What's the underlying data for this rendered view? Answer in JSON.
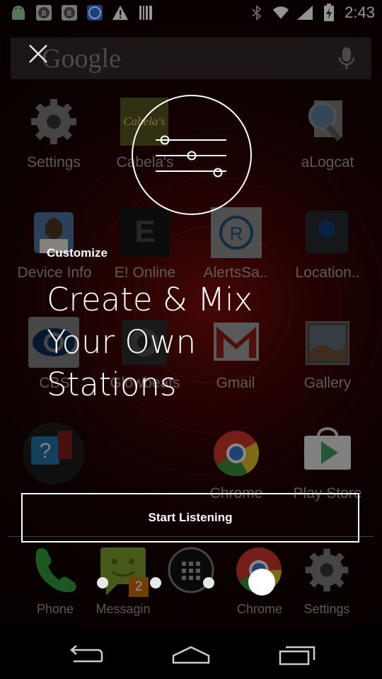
{
  "status_bar": {
    "time": "2:43",
    "left_icons": [
      "android-icon",
      "badge-b-icon",
      "badge-b-icon",
      "circle-app-icon",
      "warning-icon",
      "barcode-icon"
    ],
    "right_icons": [
      "bluetooth-icon",
      "wifi-icon",
      "signal-icon",
      "battery-charging-icon"
    ]
  },
  "search": {
    "placeholder": "Google"
  },
  "apps": [
    {
      "label": "Settings",
      "icon": "gear-icon"
    },
    {
      "label": "Cabela's",
      "icon": "cabelas-icon"
    },
    {
      "label": "aLogcat",
      "icon": "magnifier-doc-icon"
    },
    {
      "label": "Device Info",
      "icon": "device-info-icon"
    },
    {
      "label": "E! Online",
      "icon": "e-online-icon"
    },
    {
      "label": "AlertsSa..",
      "icon": "alerts-icon"
    },
    {
      "label": "Location..",
      "icon": "location-icon"
    },
    {
      "label": "CBS",
      "icon": "cbs-eye-icon"
    },
    {
      "label": "Glowbeats",
      "icon": "glowbeats-icon"
    },
    {
      "label": "Gmail",
      "icon": "gmail-icon"
    },
    {
      "label": "Gallery",
      "icon": "gallery-icon"
    },
    {
      "label": "",
      "icon": "help-folder-icon"
    },
    {
      "label": "Chrome",
      "icon": "chrome-icon"
    },
    {
      "label": "Play Store",
      "icon": "play-store-icon"
    }
  ],
  "dock": [
    {
      "label": "Phone",
      "icon": "phone-icon"
    },
    {
      "label": "Messagin",
      "icon": "messaging-icon",
      "badge": "2"
    },
    {
      "label": "",
      "icon": "app-drawer-icon"
    },
    {
      "label": "Chrome",
      "icon": "chrome-icon"
    },
    {
      "label": "Settings",
      "icon": "gear-icon"
    }
  ],
  "overlay": {
    "eyebrow": "Customize",
    "headline_line1": "Create & Mix",
    "headline_line2": "Your Own",
    "headline_line3": "Stations",
    "cta": "Start Listening",
    "page_dots_total": 5,
    "page_dots_active": 5,
    "illustration": "equalizer-sliders-icon"
  },
  "colors": {
    "overlay_text": "#ffffff",
    "wallpaper_accent": "#7a0b0b"
  }
}
